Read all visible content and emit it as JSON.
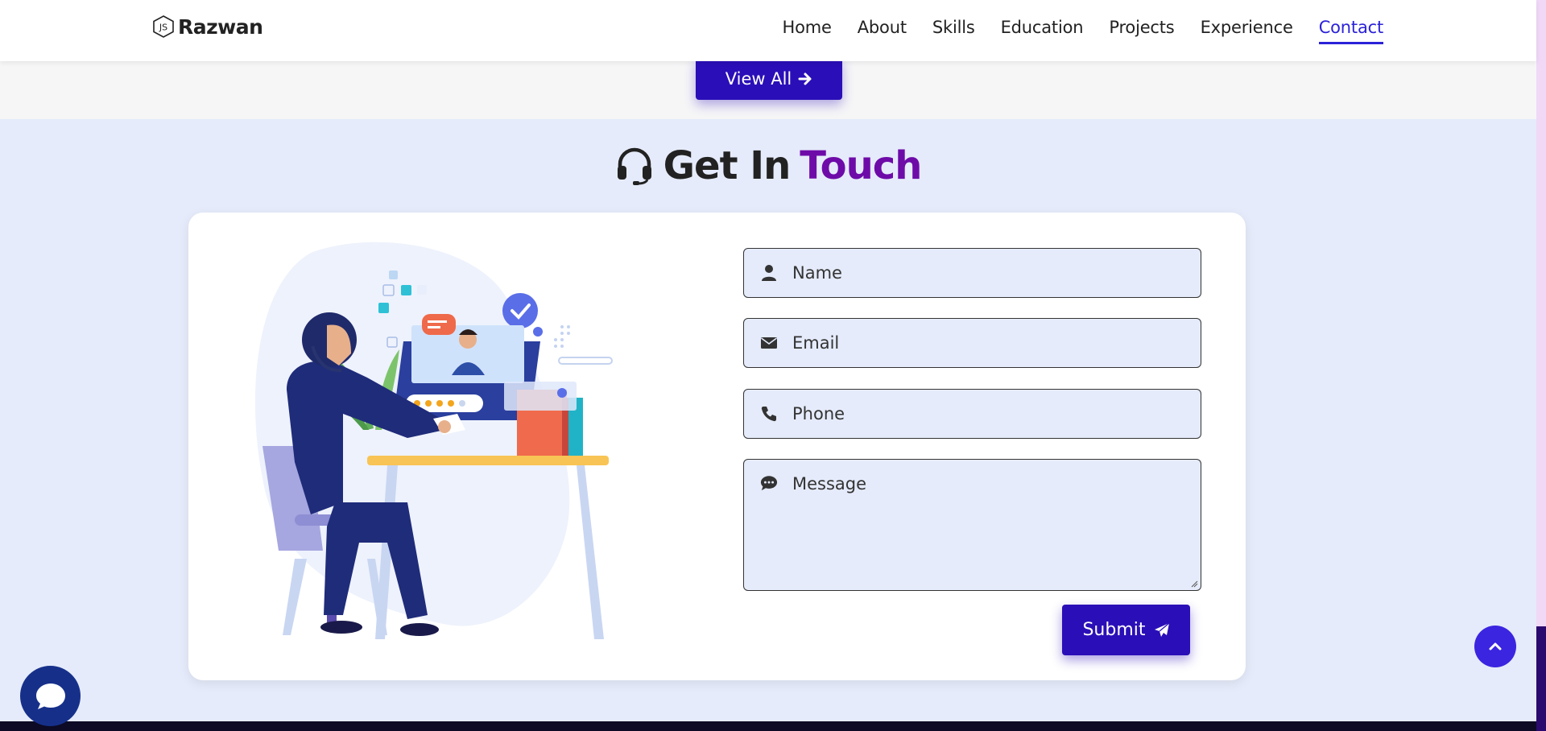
{
  "brand": {
    "name": "Razwan",
    "logo_icon": "js-hexagon-logo"
  },
  "nav": {
    "items": [
      {
        "label": "Home",
        "active": false
      },
      {
        "label": "About",
        "active": false
      },
      {
        "label": "Skills",
        "active": false
      },
      {
        "label": "Education",
        "active": false
      },
      {
        "label": "Projects",
        "active": false
      },
      {
        "label": "Experience",
        "active": false
      },
      {
        "label": "Contact",
        "active": true
      }
    ]
  },
  "projects": {
    "view_all_label": "View All",
    "view_all_icon": "arrow-right-icon"
  },
  "contact": {
    "title_part1": "Get In",
    "title_part2": "Touch",
    "title_icon": "headset-icon",
    "form": {
      "name_placeholder": "Name",
      "email_placeholder": "Email",
      "phone_placeholder": "Phone",
      "message_placeholder": "Message",
      "submit_label": "Submit",
      "submit_icon": "paper-plane-icon"
    },
    "illustration": "customer-support-person-at-desk"
  },
  "widgets": {
    "scroll_top_icon": "chevron-up-icon",
    "chat_icon": "chat-bubble-icon"
  },
  "colors": {
    "accent": "#2a0fb8",
    "title_accent": "#6e0ba8",
    "section_bg": "#e5ebfa",
    "nav_active": "#2b22d8"
  }
}
